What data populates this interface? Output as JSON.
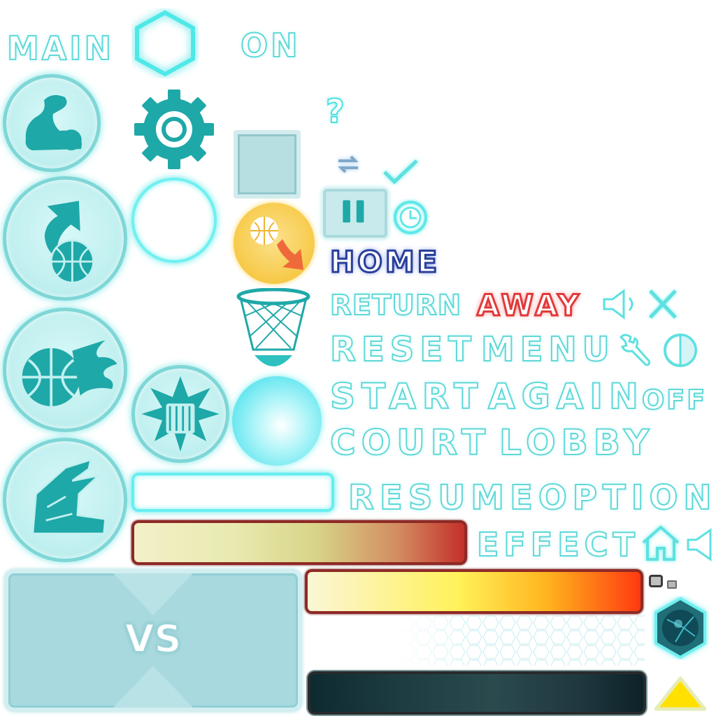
{
  "labels": {
    "main": "MAIN",
    "on": "ON",
    "help": "?",
    "home": "HOME",
    "return": "RETURN",
    "away": "AWAY",
    "reset": "RESET",
    "menu": "MENU",
    "start": "START",
    "again": "AGAIN",
    "off": "OFF",
    "court": "COURT",
    "lobby": "LOBBY",
    "resume": "RESUME",
    "option": "OPTION",
    "effect": "EFFECT",
    "vs": "VS"
  },
  "colors": {
    "accent": "#5fd8d8",
    "teal_icon": "#1fa8a8",
    "home_blue": "#2a3f9a",
    "away_red": "#e03a3a",
    "orange_button": "#f7c948",
    "yellow_arrow": "#ffe000"
  },
  "icons": [
    "flex-arm-icon",
    "hexagon-frame-icon",
    "gear-icon",
    "help-icon",
    "swap-icon",
    "check-icon",
    "pause-icon",
    "clock-icon",
    "shoot-basketball-icon",
    "ring-frame-icon",
    "basketball-drop-icon",
    "basketball-hoop-icon",
    "fire-basketball-icon",
    "fist-burst-icon",
    "glow-orb-icon",
    "hand-block-icon",
    "speaker-icon",
    "close-icon",
    "wrench-icon",
    "contrast-icon",
    "home-icon",
    "speaker-off-icon",
    "gem-orb-icon",
    "triangle-up-icon"
  ]
}
